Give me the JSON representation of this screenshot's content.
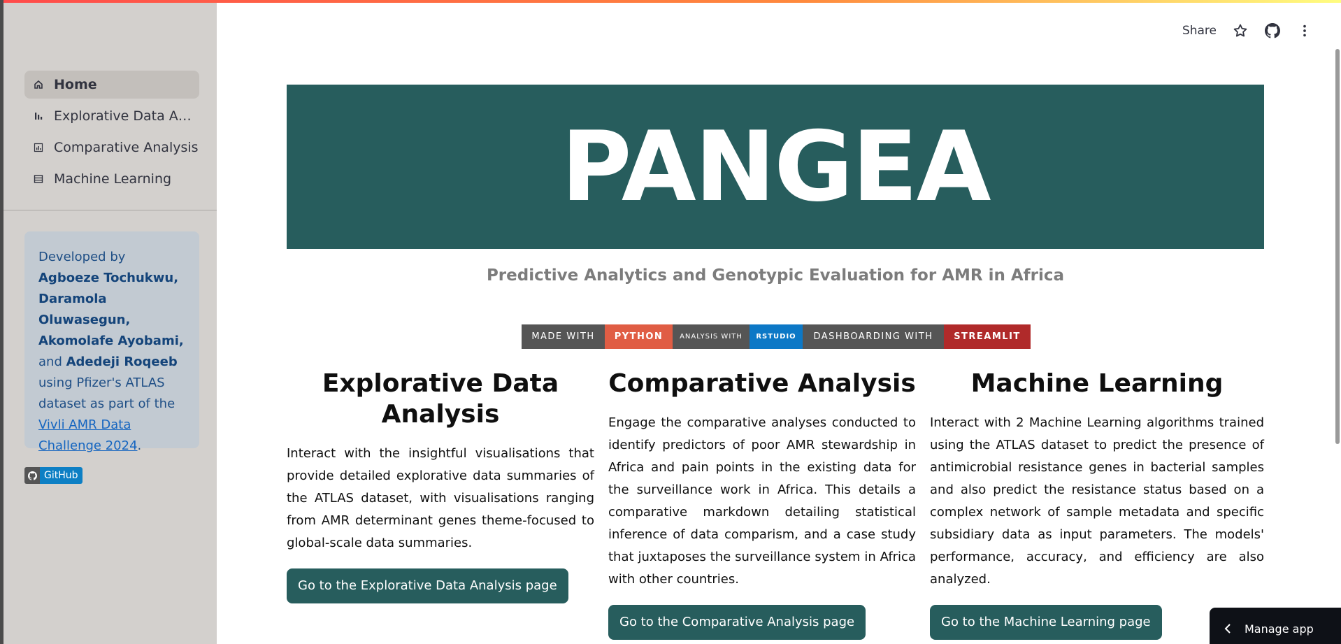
{
  "sidebar": {
    "nav": [
      {
        "label": "Home",
        "icon": "home-icon"
      },
      {
        "label": "Explorative Data Analysis",
        "icon": "bar-chart-icon"
      },
      {
        "label": "Comparative Analysis",
        "icon": "analytics-icon"
      },
      {
        "label": "Machine Learning",
        "icon": "table-icon"
      }
    ],
    "info": {
      "p1": "Developed by ",
      "authors1": "Agboeze Tochukwu, Daramola Oluwasegun, Akomolafe Ayobami,",
      "p2": " and ",
      "authors2": "Adedeji Roqeeb",
      "p3": " using Pfizer's ATLAS dataset as part of the ",
      "link": "Vivli AMR Data Challenge 2024",
      "p4": "."
    },
    "github_badge": "GitHub"
  },
  "header": {
    "share": "Share",
    "icons": [
      "star-icon",
      "github-icon",
      "more-vertical-icon"
    ]
  },
  "banner": {
    "title": "PANGEA",
    "subtitle": "Predictive Analytics and Genotypic Evaluation for AMR in Africa"
  },
  "badges": [
    "MADE WITH",
    "PYTHON",
    "ANALYSIS WITH",
    "RSTUDIO",
    "DASHBOARDING WITH",
    "STREAMLIT"
  ],
  "sections": [
    {
      "title": "Explorative Data Analysis",
      "text": "Interact with the insightful visualisations that provide detailed explorative data summaries of the ATLAS dataset, with visualisations ranging from AMR determinant genes theme-focused to global-scale data summaries.",
      "button": "Go to the Explorative Data Analysis page"
    },
    {
      "title": "Comparative Analysis",
      "text": "Engage the comparative analyses conducted to identify predictors of poor AMR stewardship in Africa and pain points in the existing data for the surveillance work in Africa. This details a comparative markdown detailing statistical inference of data comparism, and a case study that juxtaposes the surveillance system in Africa with other countries.",
      "button": "Go to the Comparative Analysis page"
    },
    {
      "title": "Machine Learning",
      "text": "Interact with 2 Machine Learning algorithms trained using the ATLAS dataset to predict the presence of antimicrobial resistance genes in bacterial samples and also predict the resistance status based on a complex network of sample metadata and specific subsidiary data as input parameters. The models' performance, accuracy, and efficiency are also analyzed.",
      "button": "Go to the Machine Learning page"
    }
  ],
  "manage_app": "Manage app",
  "colors": {
    "banner": "#275d5d",
    "sidebar": "#d3d0cd",
    "info_box": "#c2cad2"
  }
}
